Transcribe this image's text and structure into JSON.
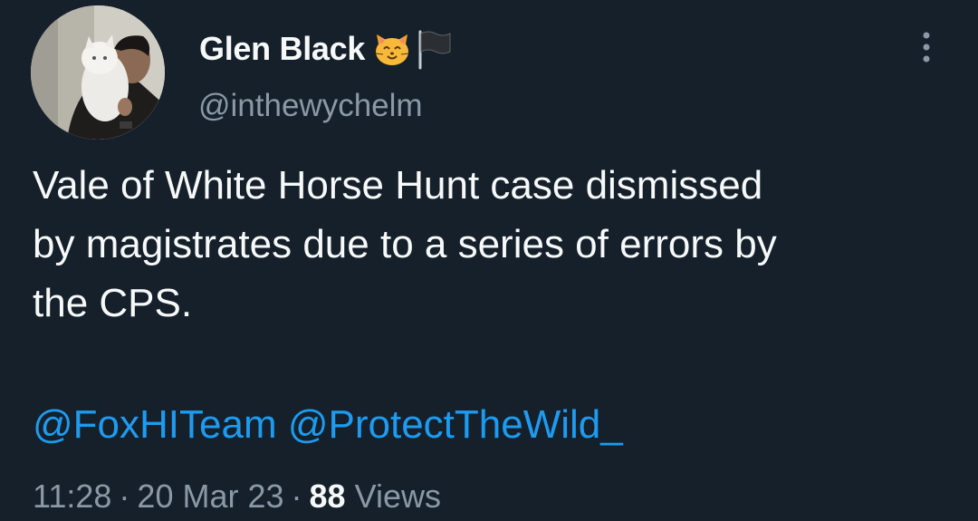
{
  "author": {
    "display_name": "Glen Black",
    "handle": "@inthewychelm",
    "name_emoji": [
      "cat-face-icon",
      "black-flag-icon"
    ]
  },
  "tweet": {
    "text": "Vale of White Horse Hunt case dismissed\nby magistrates due to a series of errors by\nthe CPS.",
    "mentions": [
      "@FoxHITeam",
      "@ProtectTheWild_"
    ]
  },
  "meta": {
    "time": "11:28",
    "separator": "·",
    "date": "20 Mar 23",
    "views_count": "88",
    "views_label": "Views"
  },
  "colors": {
    "background": "#15202b",
    "text": "#f7f9f9",
    "secondary": "#8b98a5",
    "link": "#1d9bf0"
  }
}
